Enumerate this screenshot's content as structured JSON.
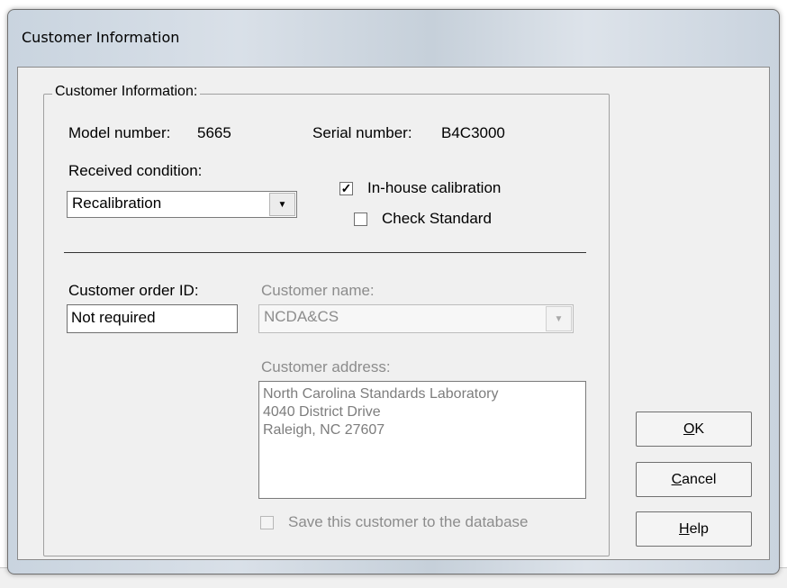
{
  "window": {
    "title": "Customer Information"
  },
  "group": {
    "label": "Customer Information:",
    "model_label": "Model number:",
    "model_value": "5665",
    "serial_label": "Serial number:",
    "serial_value": "B4C3000",
    "received_label": "Received condition:",
    "received_value": "Recalibration",
    "inhouse_label": "In-house calibration",
    "inhouse_checked": true,
    "check_standard_label": "Check Standard",
    "check_standard_checked": false,
    "order_id_label": "Customer order ID:",
    "order_id_value": "Not required",
    "customer_name_label": "Customer name:",
    "customer_name_value": "NCDA&CS",
    "customer_address_label": "Customer address:",
    "address_line1": "North Carolina Standards Laboratory",
    "address_line2": "4040 District Drive",
    "address_line3": "Raleigh, NC 27607",
    "save_customer_label": "Save this customer to the database"
  },
  "buttons": {
    "ok_mnemonic": "O",
    "ok_rest": "K",
    "cancel_mnemonic": "C",
    "cancel_rest": "ancel",
    "help_mnemonic": "H",
    "help_rest": "elp"
  },
  "icons": {
    "dropdown": "chevron-down-icon",
    "check": "checkmark-icon"
  }
}
